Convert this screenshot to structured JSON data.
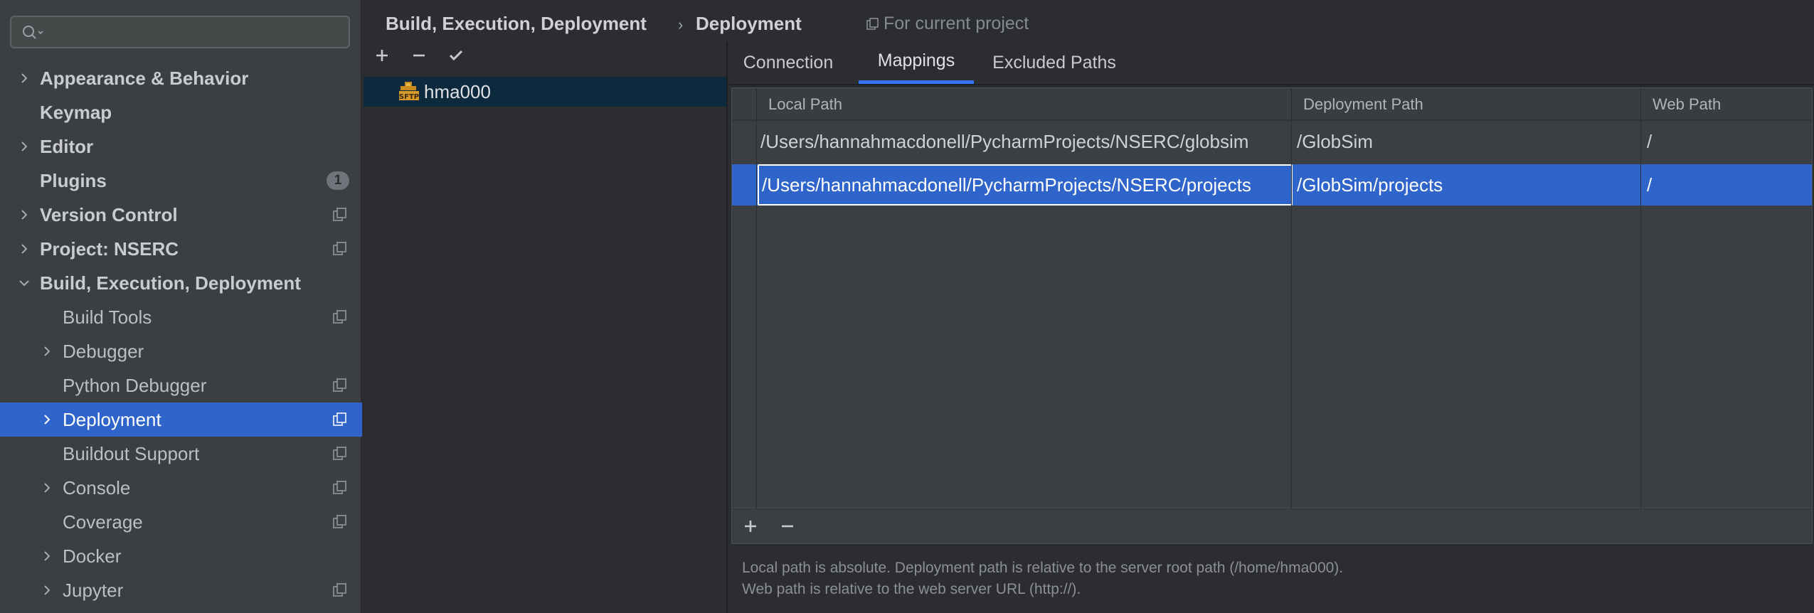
{
  "search": {
    "placeholder": ""
  },
  "sidebar": {
    "items": [
      {
        "label": "Appearance & Behavior",
        "level": 0,
        "expandable": true,
        "expanded": false
      },
      {
        "label": "Keymap",
        "level": 0,
        "expandable": false
      },
      {
        "label": "Editor",
        "level": 0,
        "expandable": true,
        "expanded": false
      },
      {
        "label": "Plugins",
        "level": 0,
        "expandable": false,
        "badge": "1"
      },
      {
        "label": "Version Control",
        "level": 0,
        "expandable": true,
        "expanded": false,
        "project_icon": true
      },
      {
        "label": "Project: NSERC",
        "level": 0,
        "expandable": true,
        "expanded": false,
        "project_icon": true
      },
      {
        "label": "Build, Execution, Deployment",
        "level": 0,
        "expandable": true,
        "expanded": true
      },
      {
        "label": "Build Tools",
        "level": 1,
        "expandable": false,
        "project_icon": true
      },
      {
        "label": "Debugger",
        "level": 1,
        "expandable": true,
        "expanded": false
      },
      {
        "label": "Python Debugger",
        "level": 1,
        "expandable": false,
        "project_icon": true
      },
      {
        "label": "Deployment",
        "level": 1,
        "expandable": true,
        "expanded": false,
        "project_icon": true,
        "selected": true
      },
      {
        "label": "Buildout Support",
        "level": 1,
        "expandable": false,
        "project_icon": true
      },
      {
        "label": "Console",
        "level": 1,
        "expandable": true,
        "expanded": false,
        "project_icon": true
      },
      {
        "label": "Coverage",
        "level": 1,
        "expandable": false,
        "project_icon": true
      },
      {
        "label": "Docker",
        "level": 1,
        "expandable": true,
        "expanded": false
      },
      {
        "label": "Jupyter",
        "level": 1,
        "expandable": true,
        "expanded": false,
        "project_icon": true
      }
    ]
  },
  "header": {
    "breadcrumb_parent": "Build, Execution, Deployment",
    "breadcrumb_sep": "›",
    "breadcrumb_current": "Deployment",
    "scope": "For current project"
  },
  "servers": {
    "items": [
      {
        "name": "hma000",
        "type_icon": "sftp-icon",
        "selected": true
      }
    ]
  },
  "tabs": [
    {
      "label": "Connection",
      "active": false
    },
    {
      "label": "Mappings",
      "active": true
    },
    {
      "label": "Excluded Paths",
      "active": false
    }
  ],
  "mappings": {
    "columns": [
      "Local Path",
      "Deployment Path",
      "Web Path"
    ],
    "rows": [
      {
        "local": "/Users/hannahmacdonell/PycharmProjects/NSERC/globsim",
        "deployment": "/GlobSim",
        "web": "/",
        "selected": false
      },
      {
        "local": "/Users/hannahmacdonell/PycharmProjects/NSERC/projects",
        "deployment": "/GlobSim/projects",
        "web": "/",
        "selected": true
      }
    ]
  },
  "help": {
    "line1": "Local path is absolute. Deployment path is relative to the server root path (/home/hma000).",
    "line2": "Web path is relative to the web server URL (http://)."
  },
  "colors": {
    "accent": "#2f65ca",
    "tab_underline": "#3574f0",
    "sidebar_bg": "#3c3f41",
    "panel_bg": "#2b2d30"
  }
}
